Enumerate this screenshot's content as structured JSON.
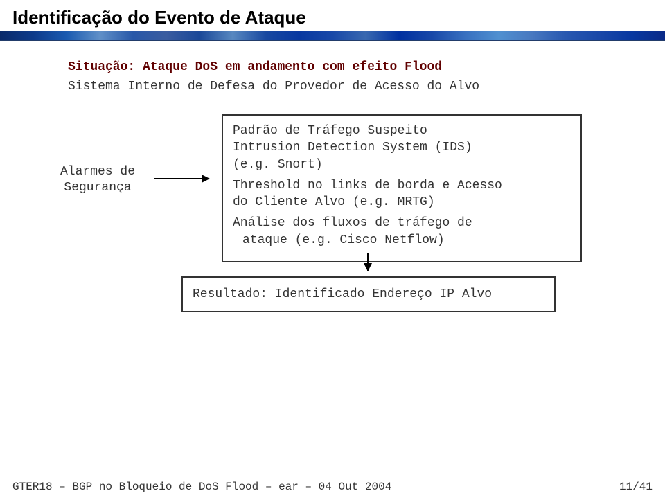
{
  "heading": "Identificação do Evento de Ataque",
  "subtitle": "Situação: Ataque DoS em andamento com efeito Flood",
  "sysinfo": "Sistema Interno de Defesa do Provedor de Acesso do Alvo",
  "alarms": {
    "l1": "Alarmes de",
    "l2": "Segurança"
  },
  "rules": {
    "r1a": "Padrão de Tráfego Suspeito",
    "r1b": "Intrusion Detection System (IDS)",
    "r1c": "(e.g. Snort)",
    "r2a": "Threshold no links de borda e Acesso",
    "r2b": "do Cliente Alvo (e.g. MRTG)",
    "r3a": "Análise dos fluxos de tráfego de",
    "r3b": "ataque (e.g. Cisco Netflow)"
  },
  "result": "Resultado: Identificado Endereço IP Alvo",
  "footer": {
    "left": "GTER18 – BGP no Bloqueio de DoS Flood – ear – 04 Out 2004",
    "right": "11/41"
  }
}
